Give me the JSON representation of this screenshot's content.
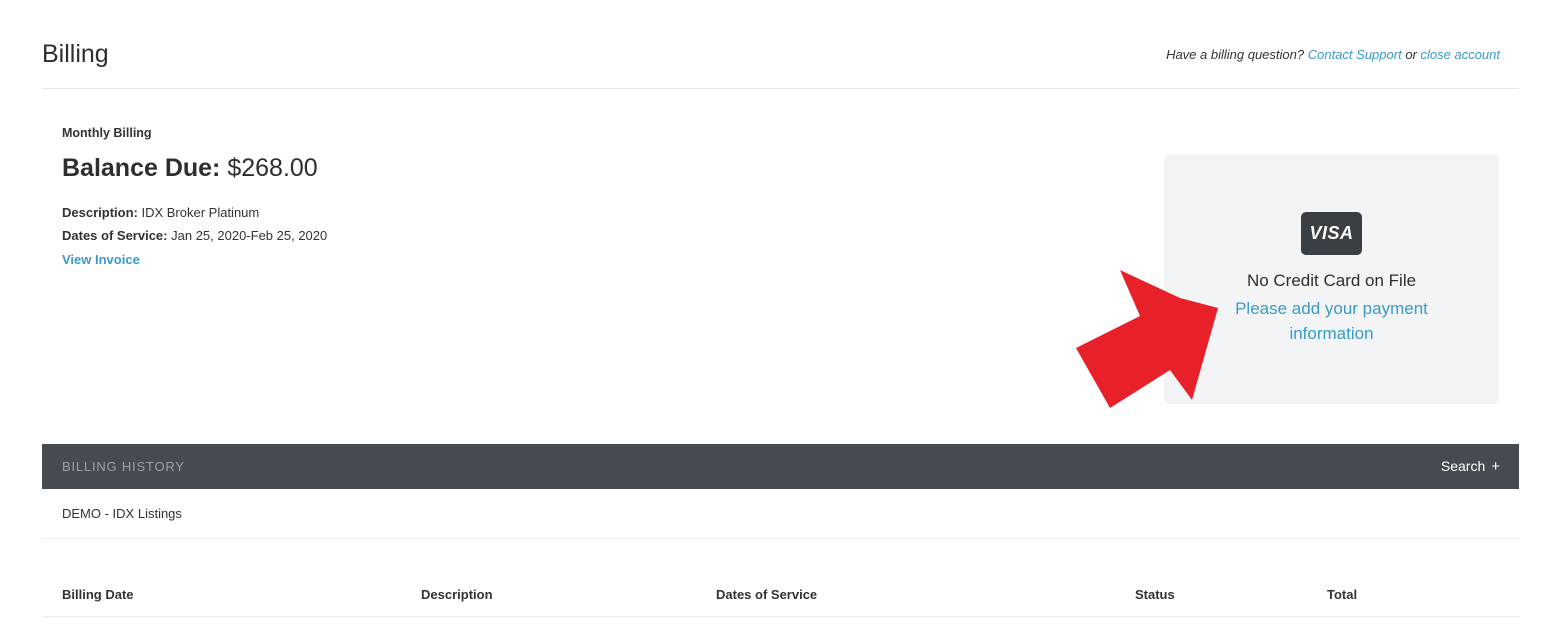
{
  "header": {
    "title": "Billing",
    "question_text": "Have a billing question?",
    "contact_support": "Contact Support",
    "or_text": "or",
    "close_account": "close account"
  },
  "summary": {
    "label": "Monthly Billing",
    "balance_label": "Balance Due:",
    "balance_value": "$268.00",
    "description_label": "Description:",
    "description_value": "IDX Broker Platinum",
    "dates_label": "Dates of Service:",
    "dates_value": "Jan 25, 2020-Feb 25, 2020",
    "view_invoice": "View Invoice"
  },
  "payment": {
    "card_brand": "VISA",
    "no_card_text": "No Credit Card on File",
    "add_payment_text": "Please add your payment information"
  },
  "annotation": {
    "arrow_color": "#e8202a"
  },
  "history": {
    "title": "BILLING HISTORY",
    "search_label": "Search",
    "search_icon": "plus-icon",
    "account_name": "DEMO - IDX Listings",
    "columns": [
      "Billing Date",
      "Description",
      "Dates of Service",
      "Status",
      "Total"
    ]
  }
}
